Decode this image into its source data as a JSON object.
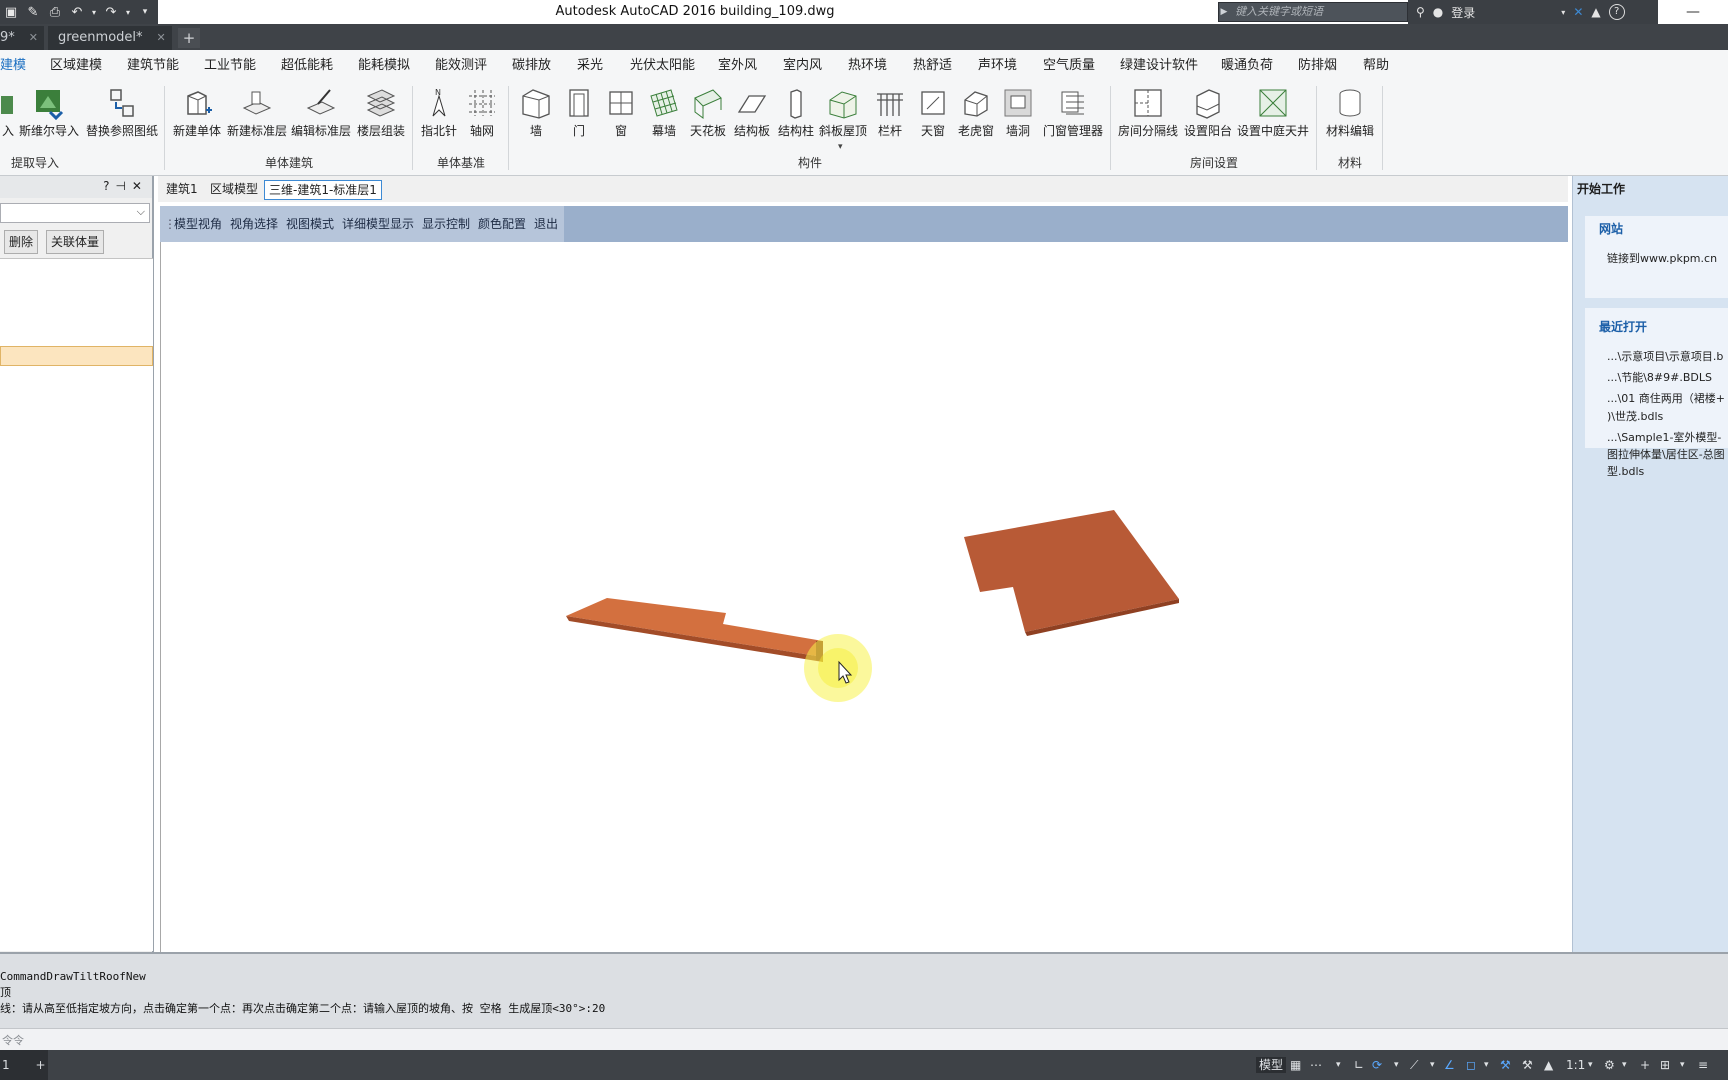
{
  "window": {
    "title": "Autodesk AutoCAD 2016    building_109.dwg"
  },
  "quick_access": [
    "save-icon",
    "save-as-icon",
    "print-icon",
    "undo-icon",
    "redo-icon",
    "customize-icon"
  ],
  "search": {
    "placeholder": "键入关键字或短语"
  },
  "account": {
    "login": "登录"
  },
  "file_tabs": [
    {
      "label": "9*"
    },
    {
      "label": "greenmodel*"
    }
  ],
  "menu": [
    "建模",
    "区域建模",
    "建筑节能",
    "工业节能",
    "超低能耗",
    "能耗模拟",
    "能效测评",
    "碳排放",
    "采光",
    "光伏太阳能",
    "室外风",
    "室内风",
    "热环境",
    "热舒适",
    "声环境",
    "空气质量",
    "绿建设计软件",
    "暖通负荷",
    "防排烟",
    "帮助"
  ],
  "ribbon": {
    "buttons": [
      "入",
      "斯维尔导入",
      "替换参照图纸",
      "新建单体",
      "新建标准层",
      "编辑标准层",
      "楼层组装",
      "指北针",
      "轴网",
      "墙",
      "门",
      "窗",
      "幕墙",
      "天花板",
      "结构板",
      "结构柱",
      "斜板屋顶",
      "栏杆",
      "天窗",
      "老虎窗",
      "墙洞",
      "门窗管理器",
      "房间分隔线",
      "设置阳台",
      "设置中庭天井",
      "材料编辑"
    ],
    "groups": [
      "提取导入",
      "单体建筑",
      "单体基准",
      "构件",
      "房间设置",
      "材料"
    ]
  },
  "left_palette": {
    "buttons": [
      "删除",
      "关联体量"
    ]
  },
  "doc_tabs": [
    {
      "label": "建筑1"
    },
    {
      "label": "区域模型"
    },
    {
      "label": "三维-建筑1-标准层1"
    }
  ],
  "doc_toolbar": [
    "模型视角",
    "视角选择",
    "视图模式",
    "详细模型显示",
    "显示控制",
    "颜色配置",
    "退出"
  ],
  "start_panel": {
    "title": "开始工作",
    "website_head": "网站",
    "website_link": "链接到www.pkpm.cn",
    "recent_head": "最近打开",
    "recent": [
      "...\\示意项目\\示意项目.b",
      "...\\节能\\8#9#.BDLS",
      "...\\01 商住两用（裙楼+",
      ")\\世茂.bdls",
      "...\\Sample1-室外模型-",
      "图拉伸体量\\居住区-总图",
      "型.bdls"
    ]
  },
  "command_history": [
    "CommandDrawTiltRoofNew",
    "顶",
    "线：请从高至低指定坡方向，点击确定第一个点：再次点击确定第二个点：请输入屋顶的坡角、按 空格 生成屋顶<30°>:20"
  ],
  "command_input": {
    "placeholder": "令令"
  },
  "status_bar": {
    "mode": "模型",
    "scale": "1:1",
    "layout_tab": "1"
  },
  "colors": {
    "slab": "#b85a36",
    "slab_top": "#c8653c",
    "toolbar": "#9aafcb",
    "accent": "#1b6fc2"
  }
}
